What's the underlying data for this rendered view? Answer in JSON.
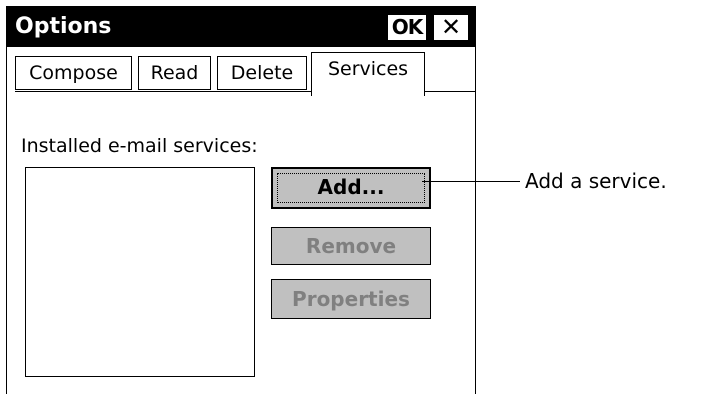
{
  "window": {
    "title": "Options",
    "ok_label": "OK",
    "close_label": "✕"
  },
  "tabs": [
    {
      "label": "Compose",
      "selected": false
    },
    {
      "label": "Read",
      "selected": false
    },
    {
      "label": "Delete",
      "selected": false
    },
    {
      "label": "Services",
      "selected": true
    }
  ],
  "services": {
    "list_label": "Installed e-mail services:",
    "items": [],
    "buttons": {
      "add": "Add...",
      "remove": "Remove",
      "properties": "Properties"
    }
  },
  "callout": {
    "text": "Add a service."
  },
  "colors": {
    "titlebar": "#000000",
    "button_face": "#c0c0c0",
    "disabled_text": "#808080"
  }
}
